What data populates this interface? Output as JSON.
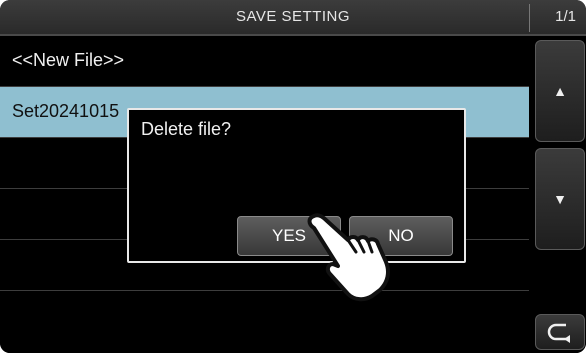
{
  "header": {
    "title": "SAVE SETTING",
    "page_indicator": "1/1"
  },
  "list": {
    "items": [
      {
        "label": "<<New File>>",
        "selected": false
      },
      {
        "label": "Set20241015",
        "selected": true
      },
      {
        "label": "",
        "selected": false
      },
      {
        "label": "",
        "selected": false
      },
      {
        "label": "",
        "selected": false
      },
      {
        "label": "",
        "selected": false
      }
    ]
  },
  "side_buttons": {
    "up_icon": "triangle-up-icon",
    "down_icon": "triangle-down-icon",
    "back_icon": "return-arrow-icon"
  },
  "dialog": {
    "message": "Delete file?",
    "yes_label": "YES",
    "no_label": "NO"
  },
  "colors": {
    "selected_row": "#8fbfd0",
    "background": "#000000",
    "text": "#f0f0f0"
  }
}
